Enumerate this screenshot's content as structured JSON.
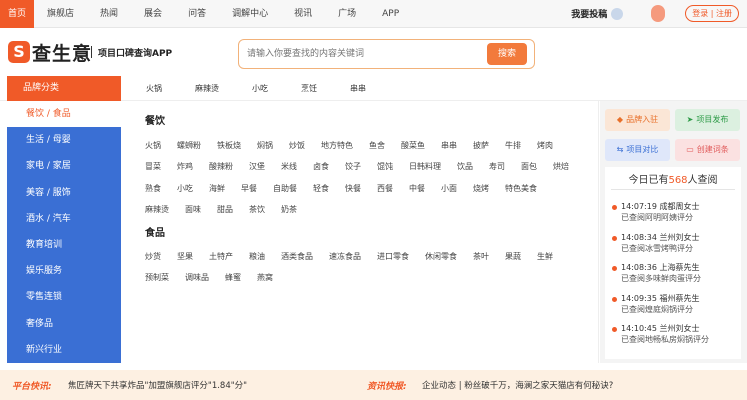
{
  "topnav": {
    "items": [
      "首页",
      "旗舰店",
      "热闻",
      "展会",
      "问答",
      "调解中心",
      "视讯",
      "广场",
      "APP"
    ],
    "post_label": "我要投稿",
    "login": "登录",
    "register": "注册"
  },
  "header": {
    "logo_mark": "S",
    "logo_text": "查生意",
    "slogan": "项目口碑查询APP",
    "search_placeholder": "请输入你要查找的内容关键词",
    "search_button": "搜索"
  },
  "catbar": {
    "brand_label": "品牌分类",
    "links": [
      "火锅",
      "麻辣烫",
      "小吃",
      "烹饪",
      "串串"
    ]
  },
  "sidebar": {
    "items": [
      "餐饮 / 食品",
      "生活 / 母婴",
      "家电 / 家居",
      "美容 / 服饰",
      "酒水 / 汽车",
      "教育培训",
      "娱乐服务",
      "零售连锁",
      "奢侈品",
      "新兴行业"
    ]
  },
  "panel": {
    "groups": [
      {
        "title": "餐饮",
        "tags": [
          "火锅",
          "螺蛳粉",
          "铁板烧",
          "焖锅",
          "炒饭",
          "地方特色",
          "鱼舍",
          "酸菜鱼",
          "串串",
          "披萨",
          "牛排",
          "烤肉",
          "冒菜",
          "炸鸡",
          "酸辣粉",
          "汉堡",
          "米线",
          "卤食",
          "饺子",
          "馄饨",
          "日韩料理",
          "饮品",
          "寿司",
          "面包",
          "烘焙",
          "熟食",
          "小吃",
          "海鲜",
          "早餐",
          "自助餐",
          "轻食",
          "快餐",
          "西餐",
          "中餐",
          "小面",
          "烧烤",
          "特色美食",
          "麻辣烫",
          "面味",
          "甜品",
          "茶饮",
          "奶茶"
        ]
      },
      {
        "title": "食品",
        "tags": [
          "炒货",
          "坚果",
          "土特产",
          "粮油",
          "酒类食品",
          "速冻食品",
          "进口零食",
          "休闲零食",
          "茶叶",
          "果蔬",
          "生鲜",
          "预制菜",
          "调味品",
          "蜂蜜",
          "燕窝"
        ]
      }
    ]
  },
  "right": {
    "buttons": [
      "品牌入驻",
      "项目发布",
      "项目对比",
      "创建词条"
    ],
    "feed_prefix": "今日已有",
    "feed_count": "568",
    "feed_suffix": "人查阅",
    "feed": [
      {
        "line1": "14:07:19  成都周女士",
        "line2": "已查阅阿明阿姨评分"
      },
      {
        "line1": "14:08:34  兰州刘女士",
        "line2": "已查阅冰雪烤鸭评分"
      },
      {
        "line1": "14:08:36  上海蔡先生",
        "line2": "已查阅多味鲜肉蛋评分"
      },
      {
        "line1": "14:09:35  福州蔡先生",
        "line2": "已查阅煌庭焖锅评分"
      },
      {
        "line1": "14:10:45  兰州刘女士",
        "line2": "已查阅地畅私房焖锅评分"
      }
    ]
  },
  "ticker": {
    "label1": "平台快讯:",
    "text1": "焦匠牌天下共享炸品\"加盟旗舰店评分\"1.84\"分\"",
    "label2": "资讯快报:",
    "text2": "企业动态 | 粉丝破千万，海澜之家天猫店有何秘诀?"
  },
  "colors": {
    "accent": "#f05a28",
    "sidebar_bg": "#3a6fd4"
  }
}
